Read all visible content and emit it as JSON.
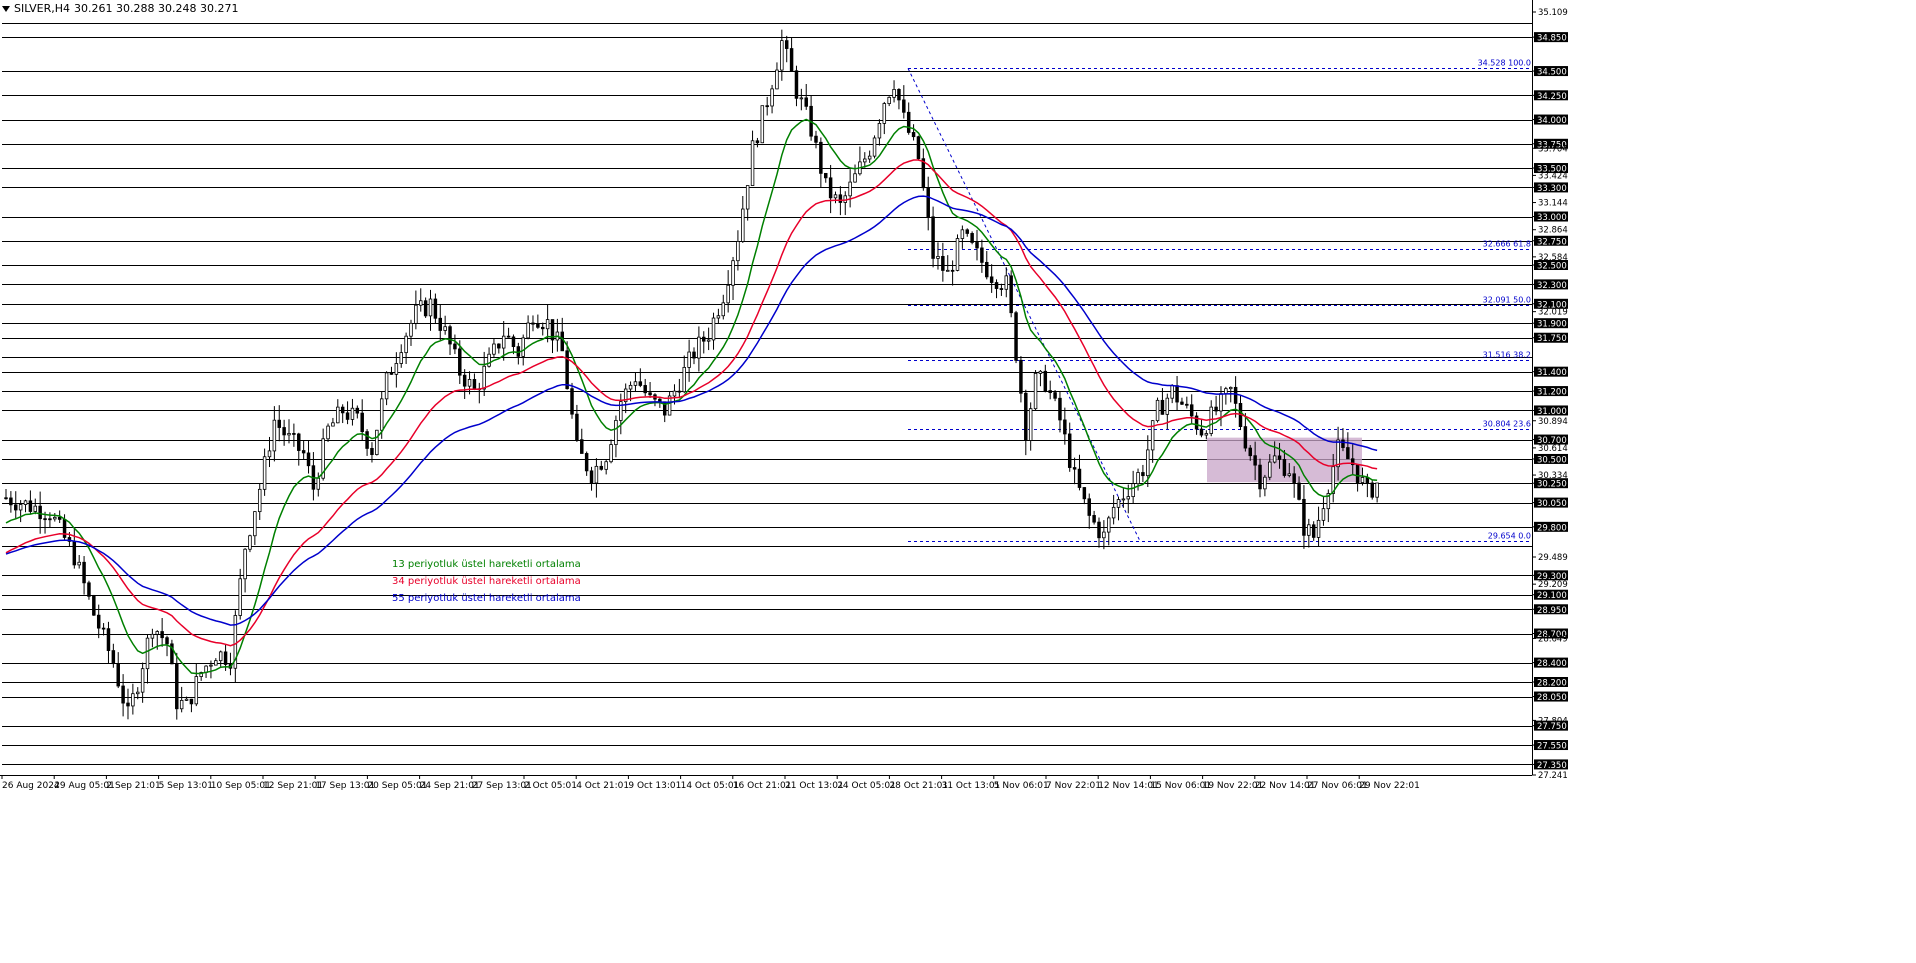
{
  "header": {
    "symbol": "SILVER,H4",
    "ohlc": "30.261 30.288 30.248 30.271"
  },
  "legend": [
    {
      "label": "13 periyotluk üstel hareketli ortalama",
      "color": "#008000"
    },
    {
      "label": "34 periyotluk üstel hareketli ortalama",
      "color": "#e8002a"
    },
    {
      "label": "55 periyotluk üstel hareketli ortalama",
      "color": "#0000cc"
    }
  ],
  "chart_data": {
    "type": "candlestick",
    "symbol": "SILVER",
    "timeframe": "H4",
    "ylim": [
      27.241,
      35.109
    ],
    "price_ticks": [
      "35.109",
      "34.850",
      "34.500",
      "34.250",
      "34.000",
      "33.750",
      "33.704",
      "33.500",
      "33.424",
      "33.300",
      "33.144",
      "33.000",
      "32.864",
      "32.750",
      "32.584",
      "32.500",
      "32.300",
      "32.100",
      "32.019",
      "31.900",
      "31.750",
      "31.400",
      "31.200",
      "31.000",
      "30.894",
      "30.700",
      "30.614",
      "30.500",
      "30.334",
      "30.250",
      "30.050",
      "29.800",
      "29.489",
      "29.300",
      "29.209",
      "29.100",
      "28.950",
      "28.700",
      "28.649",
      "28.400",
      "28.200",
      "28.050",
      "27.804",
      "27.750",
      "27.550",
      "27.350",
      "27.241"
    ],
    "horizontal_levels": [
      35.0,
      34.85,
      34.5,
      34.25,
      34.0,
      33.75,
      33.5,
      33.3,
      33.0,
      32.75,
      32.5,
      32.3,
      32.1,
      31.9,
      31.75,
      31.55,
      31.4,
      31.2,
      31.0,
      30.7,
      30.5,
      30.25,
      30.05,
      29.8,
      29.6,
      29.3,
      29.1,
      28.95,
      28.7,
      28.4,
      28.2,
      28.05,
      27.75,
      27.55,
      27.35
    ],
    "highlighted_levels": [
      "35.000",
      "34.850",
      "34.500",
      "34.250",
      "34.000",
      "33.750",
      "33.500",
      "33.300",
      "33.000",
      "32.750",
      "32.500",
      "32.300",
      "32.100",
      "31.900",
      "31.750",
      "31.400",
      "31.200",
      "31.000",
      "30.700",
      "30.500",
      "30.250",
      "30.050",
      "29.800",
      "29.600",
      "29.300",
      "29.100",
      "28.950",
      "28.700",
      "28.400",
      "28.200",
      "28.050",
      "27.750",
      "27.550",
      "27.350"
    ],
    "x_labels": [
      "26 Aug 2024",
      "29 Aug 05:01",
      "2 Sep 21:01",
      "5 Sep 13:01",
      "10 Sep 05:01",
      "12 Sep 21:01",
      "17 Sep 13:01",
      "20 Sep 05:01",
      "24 Sep 21:01",
      "27 Sep 13:01",
      "2 Oct 05:01",
      "4 Oct 21:01",
      "9 Oct 13:01",
      "14 Oct 05:01",
      "16 Oct 21:01",
      "21 Oct 13:01",
      "24 Oct 05:01",
      "28 Oct 21:01",
      "31 Oct 13:01",
      "5 Nov 06:01",
      "7 Nov 22:01",
      "12 Nov 14:01",
      "15 Nov 06:01",
      "19 Nov 22:01",
      "22 Nov 14:01",
      "27 Nov 06:01",
      "29 Nov 22:01"
    ],
    "fibonacci": [
      {
        "price": 34.528,
        "label": "34.528 100.0"
      },
      {
        "price": 32.666,
        "label": "32.666 61.8"
      },
      {
        "price": 32.091,
        "label": "32.091 50.0"
      },
      {
        "price": 31.516,
        "label": "31.516 38.2"
      },
      {
        "price": 30.804,
        "label": "30.804 23.6"
      },
      {
        "price": 29.654,
        "label": "29.654 0.0"
      }
    ],
    "fib_swing": {
      "from_price": 34.528,
      "to_price": 29.654
    },
    "zone": {
      "top": 30.72,
      "bottom": 30.26,
      "color": "#c8a4c8"
    },
    "series": [
      {
        "name": "13 periyotluk üstel hareketli ortalama",
        "color": "#008000",
        "period": 13
      },
      {
        "name": "34 periyotluk üstel hareketli ortalama",
        "color": "#e8002a",
        "period": 34
      },
      {
        "name": "55 periyotluk üstel hareketli ortalama",
        "color": "#0000cc",
        "period": 55
      }
    ],
    "price_path": [
      [
        0,
        30.1
      ],
      [
        9,
        29.95
      ],
      [
        14,
        29.5
      ],
      [
        18,
        28.9
      ],
      [
        22,
        28.4
      ],
      [
        25,
        27.85
      ],
      [
        27,
        28.2
      ],
      [
        30,
        28.8
      ],
      [
        33,
        28.6
      ],
      [
        35,
        28.0
      ],
      [
        37,
        27.95
      ],
      [
        40,
        28.3
      ],
      [
        43,
        28.5
      ],
      [
        46,
        28.45
      ],
      [
        49,
        29.6
      ],
      [
        52,
        30.2
      ],
      [
        55,
        30.9
      ],
      [
        58,
        30.7
      ],
      [
        61,
        30.55
      ],
      [
        63,
        30.2
      ],
      [
        66,
        30.8
      ],
      [
        69,
        31.0
      ],
      [
        72,
        30.9
      ],
      [
        75,
        30.6
      ],
      [
        78,
        31.3
      ],
      [
        81,
        31.7
      ],
      [
        84,
        32.0
      ],
      [
        87,
        32.1
      ],
      [
        90,
        31.8
      ],
      [
        93,
        31.4
      ],
      [
        96,
        31.2
      ],
      [
        99,
        31.5
      ],
      [
        102,
        31.8
      ],
      [
        105,
        31.6
      ],
      [
        108,
        32.0
      ],
      [
        111,
        31.9
      ],
      [
        114,
        31.6
      ],
      [
        117,
        30.6
      ],
      [
        120,
        30.35
      ],
      [
        123,
        30.55
      ],
      [
        126,
        31.1
      ],
      [
        129,
        31.35
      ],
      [
        132,
        31.1
      ],
      [
        135,
        31.0
      ],
      [
        138,
        31.3
      ],
      [
        141,
        31.6
      ],
      [
        144,
        31.8
      ],
      [
        147,
        32.2
      ],
      [
        150,
        32.8
      ],
      [
        153,
        33.7
      ],
      [
        156,
        34.2
      ],
      [
        159,
        34.8
      ],
      [
        162,
        34.3
      ],
      [
        165,
        33.9
      ],
      [
        168,
        33.3
      ],
      [
        171,
        33.1
      ],
      [
        174,
        33.4
      ],
      [
        177,
        33.7
      ],
      [
        180,
        34.2
      ],
      [
        182,
        34.4
      ],
      [
        184,
        34.0
      ],
      [
        187,
        33.6
      ],
      [
        190,
        32.6
      ],
      [
        193,
        32.4
      ],
      [
        196,
        32.8
      ],
      [
        199,
        32.6
      ],
      [
        202,
        32.4
      ],
      [
        205,
        32.3
      ],
      [
        207,
        31.6
      ],
      [
        209,
        30.8
      ],
      [
        211,
        31.3
      ],
      [
        213,
        31.3
      ],
      [
        216,
        30.9
      ],
      [
        219,
        30.3
      ],
      [
        222,
        29.9
      ],
      [
        225,
        29.7
      ],
      [
        227,
        30.0
      ],
      [
        230,
        30.2
      ],
      [
        233,
        30.4
      ],
      [
        236,
        31.0
      ],
      [
        239,
        31.2
      ],
      [
        242,
        31.0
      ],
      [
        245,
        30.8
      ],
      [
        248,
        31.0
      ],
      [
        251,
        31.2
      ],
      [
        254,
        30.7
      ],
      [
        257,
        30.3
      ],
      [
        260,
        30.5
      ],
      [
        263,
        30.4
      ],
      [
        266,
        29.8
      ],
      [
        268,
        29.7
      ],
      [
        271,
        30.25
      ],
      [
        273,
        30.6
      ],
      [
        276,
        30.45
      ],
      [
        279,
        30.15
      ],
      [
        281,
        30.25
      ]
    ]
  }
}
